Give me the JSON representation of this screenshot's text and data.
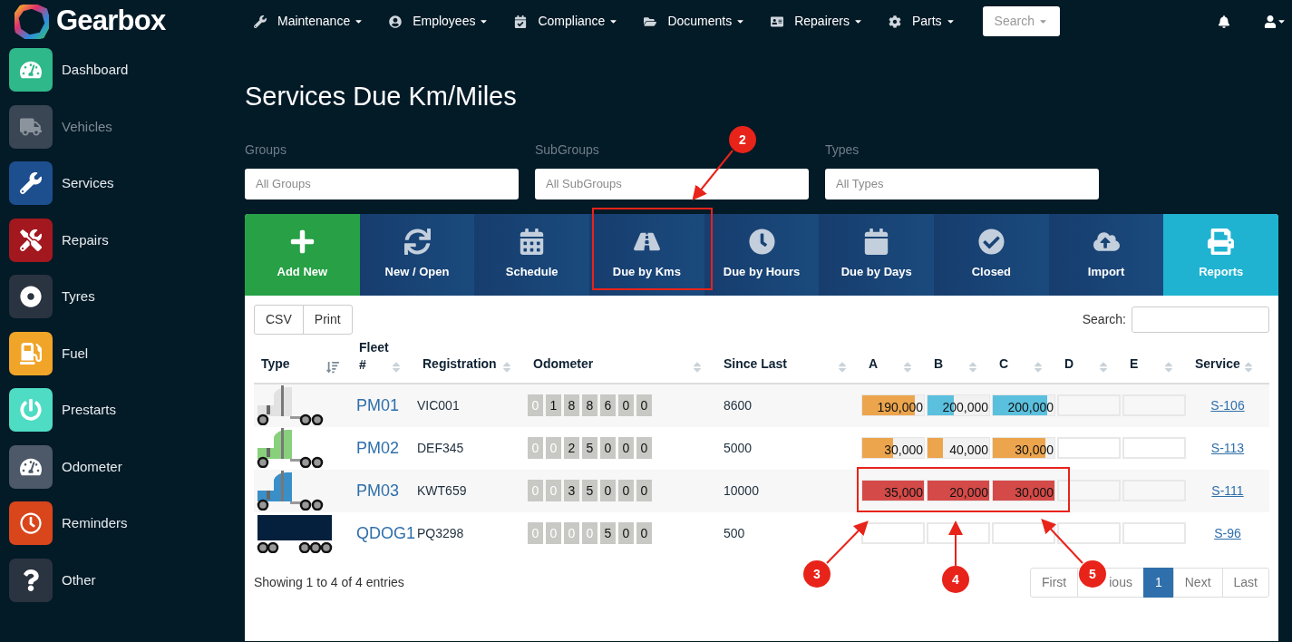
{
  "brand": "Gearbox",
  "nav": [
    {
      "label": "Maintenance"
    },
    {
      "label": "Employees"
    },
    {
      "label": "Compliance"
    },
    {
      "label": "Documents"
    },
    {
      "label": "Repairers"
    },
    {
      "label": "Parts"
    }
  ],
  "nav_search": {
    "label": "Search"
  },
  "sidebar": {
    "items": [
      {
        "label": "Dashboard",
        "color": "#2fb88a",
        "disabled": false
      },
      {
        "label": "Vehicles",
        "color": "#3a4654",
        "disabled": true
      },
      {
        "label": "Services",
        "color": "#1d4f8f",
        "disabled": false
      },
      {
        "label": "Repairs",
        "color": "#a3181f",
        "disabled": false
      },
      {
        "label": "Tyres",
        "color": "#2a3340",
        "disabled": false
      },
      {
        "label": "Fuel",
        "color": "#f0a528",
        "disabled": false
      },
      {
        "label": "Prestarts",
        "color": "#4fdcc4",
        "disabled": false
      },
      {
        "label": "Odometer",
        "color": "#4d5868",
        "disabled": false
      },
      {
        "label": "Reminders",
        "color": "#d9461c",
        "disabled": false
      },
      {
        "label": "Other",
        "color": "#2a3340",
        "disabled": false
      }
    ]
  },
  "page_title": "Services Due Km/Miles",
  "filters": [
    {
      "label": "Groups",
      "placeholder": "All Groups"
    },
    {
      "label": "SubGroups",
      "placeholder": "All SubGroups"
    },
    {
      "label": "Types",
      "placeholder": "All Types"
    }
  ],
  "toolbar": [
    {
      "label": "Add New",
      "kind": "primary"
    },
    {
      "label": "New / Open",
      "kind": "default"
    },
    {
      "label": "Schedule",
      "kind": "default"
    },
    {
      "label": "Due by Kms",
      "kind": "default"
    },
    {
      "label": "Due by Hours",
      "kind": "default"
    },
    {
      "label": "Due by Days",
      "kind": "default"
    },
    {
      "label": "Closed",
      "kind": "default"
    },
    {
      "label": "Import",
      "kind": "default"
    },
    {
      "label": "Reports",
      "kind": "info"
    }
  ],
  "export_buttons": [
    "CSV",
    "Print"
  ],
  "table_search": {
    "label": "Search:"
  },
  "table": {
    "columns": [
      {
        "label": "Type",
        "sorted": true
      },
      {
        "label": "Fleet #",
        "sorted": false
      },
      {
        "label": "Registration",
        "sorted": false
      },
      {
        "label": "Odometer",
        "sorted": false
      },
      {
        "label": "Since Last",
        "sorted": false
      },
      {
        "label": "A",
        "sorted": false
      },
      {
        "label": "B",
        "sorted": false
      },
      {
        "label": "C",
        "sorted": false
      },
      {
        "label": "D",
        "sorted": false
      },
      {
        "label": "E",
        "sorted": false
      },
      {
        "label": "Service",
        "sorted": false
      }
    ],
    "rows": [
      {
        "vehicle": {
          "kind": "truck",
          "color": "#e2e2e2"
        },
        "fleet": "PM01",
        "registration": "VIC001",
        "odometer": [
          {
            "digit": "0",
            "dim": true
          },
          {
            "digit": "1",
            "dim": false
          },
          {
            "digit": "8",
            "dim": false
          },
          {
            "digit": "8",
            "dim": false
          },
          {
            "digit": "6",
            "dim": false
          },
          {
            "digit": "0",
            "dim": false
          },
          {
            "digit": "0",
            "dim": false
          }
        ],
        "since_last": "8600",
        "intervals": [
          {
            "kind": "bar",
            "value": "190,000",
            "level": 0.85,
            "color": "#eca54d"
          },
          {
            "kind": "bar",
            "value": "200,000",
            "level": 0.43,
            "color": "#5bc0de"
          },
          {
            "kind": "bar",
            "value": "200,000",
            "level": 0.88,
            "color": "#5bc0de"
          },
          {
            "kind": "empty",
            "level": 0
          },
          {
            "kind": "empty",
            "level": 0
          }
        ],
        "service": "S-106"
      },
      {
        "vehicle": {
          "kind": "truck",
          "color": "#88d07c"
        },
        "fleet": "PM02",
        "registration": "DEF345",
        "odometer": [
          {
            "digit": "0",
            "dim": true
          },
          {
            "digit": "0",
            "dim": true
          },
          {
            "digit": "2",
            "dim": false
          },
          {
            "digit": "5",
            "dim": false
          },
          {
            "digit": "0",
            "dim": false
          },
          {
            "digit": "0",
            "dim": false
          },
          {
            "digit": "0",
            "dim": false
          }
        ],
        "since_last": "5000",
        "intervals": [
          {
            "kind": "bar",
            "value": "30,000",
            "level": 0.5,
            "color": "#eca54d"
          },
          {
            "kind": "bar",
            "value": "40,000",
            "level": 0.25,
            "color": "#eca54d"
          },
          {
            "kind": "bar",
            "value": "30,000",
            "level": 0.85,
            "color": "#eca54d"
          },
          {
            "kind": "empty",
            "level": 0
          },
          {
            "kind": "empty",
            "level": 0
          }
        ],
        "service": "S-113"
      },
      {
        "vehicle": {
          "kind": "truck",
          "color": "#3a8fc8"
        },
        "fleet": "PM03",
        "registration": "KWT659",
        "odometer": [
          {
            "digit": "0",
            "dim": true
          },
          {
            "digit": "0",
            "dim": true
          },
          {
            "digit": "3",
            "dim": false
          },
          {
            "digit": "5",
            "dim": false
          },
          {
            "digit": "0",
            "dim": false
          },
          {
            "digit": "0",
            "dim": false
          },
          {
            "digit": "0",
            "dim": false
          }
        ],
        "since_last": "10000",
        "intervals": [
          {
            "kind": "bar",
            "value": "35,000",
            "level": 1,
            "color": "#d44a48"
          },
          {
            "kind": "bar",
            "value": "20,000",
            "level": 1,
            "color": "#d44a48"
          },
          {
            "kind": "bar",
            "value": "30,000",
            "level": 1,
            "color": "#d44a48"
          },
          {
            "kind": "empty",
            "level": 0
          },
          {
            "kind": "empty",
            "level": 0
          }
        ],
        "service": "S-111"
      },
      {
        "vehicle": {
          "kind": "trailer",
          "color": "#04203d"
        },
        "fleet": "QDOG1",
        "registration": "PQ3298",
        "odometer": [
          {
            "digit": "0",
            "dim": true
          },
          {
            "digit": "0",
            "dim": true
          },
          {
            "digit": "0",
            "dim": true
          },
          {
            "digit": "0",
            "dim": true
          },
          {
            "digit": "5",
            "dim": false
          },
          {
            "digit": "0",
            "dim": false
          },
          {
            "digit": "0",
            "dim": false
          }
        ],
        "since_last": "500",
        "intervals": [
          {
            "kind": "empty",
            "level": 0
          },
          {
            "kind": "empty",
            "level": 0
          },
          {
            "kind": "empty",
            "level": 0
          },
          {
            "kind": "empty",
            "level": 0
          },
          {
            "kind": "empty",
            "level": 0
          }
        ],
        "service": "S-96"
      }
    ]
  },
  "info": "Showing 1 to 4 of 4 entries",
  "pagination": [
    {
      "label": "First",
      "selected": false
    },
    {
      "label": "ious",
      "selected": false
    },
    {
      "label": "1",
      "selected": true
    },
    {
      "label": "Next",
      "selected": false
    },
    {
      "label": "Last",
      "selected": false
    }
  ],
  "annotations": [
    {
      "label": "2"
    },
    {
      "label": "3"
    },
    {
      "label": "4"
    },
    {
      "label": "5"
    }
  ]
}
